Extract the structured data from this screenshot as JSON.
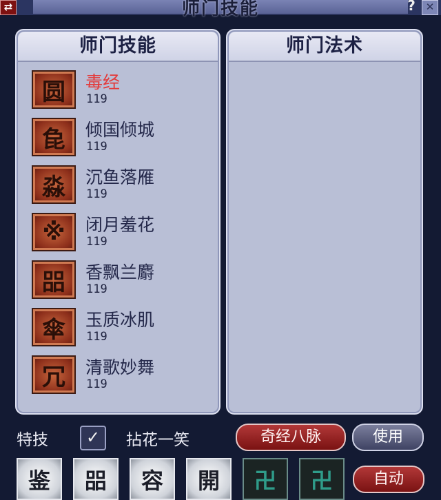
{
  "window": {
    "title": "师门技能",
    "back_icon": "⇄",
    "help_icon": "?",
    "close_icon": "✕"
  },
  "tabs": {
    "skills_header": "师门技能",
    "spells_header": "师门法术"
  },
  "skills": [
    {
      "name": "毒经",
      "level": "119",
      "icon": "圆",
      "selected": true
    },
    {
      "name": "倾国倾城",
      "level": "119",
      "icon": "㲋"
    },
    {
      "name": "沉鱼落雁",
      "level": "119",
      "icon": "淼"
    },
    {
      "name": "闭月羞花",
      "level": "119",
      "icon": "※"
    },
    {
      "name": "香飘兰麝",
      "level": "119",
      "icon": "㗊"
    },
    {
      "name": "玉质冰肌",
      "level": "119",
      "icon": "傘"
    },
    {
      "name": "清歌妙舞",
      "level": "119",
      "icon": "冗"
    }
  ],
  "special": {
    "label": "特技",
    "checked": true,
    "checkbox_icon": "✓",
    "skill_name": "拈花一笑"
  },
  "buttons": {
    "meridian": "奇经八脉",
    "use": "使用",
    "auto": "自动"
  },
  "hotbar": [
    {
      "icon": "鉴",
      "style": "light"
    },
    {
      "icon": "㗊",
      "style": "light"
    },
    {
      "icon": "容",
      "style": "light"
    },
    {
      "icon": "開",
      "style": "light"
    },
    {
      "icon": "卍",
      "style": "dark"
    },
    {
      "icon": "卍",
      "style": "dark"
    }
  ],
  "colors": {
    "selected_skill": "#e33b3b",
    "panel_bg": "#b9bfd6",
    "window_bg": "#131a33",
    "red_button": "#a02424"
  }
}
